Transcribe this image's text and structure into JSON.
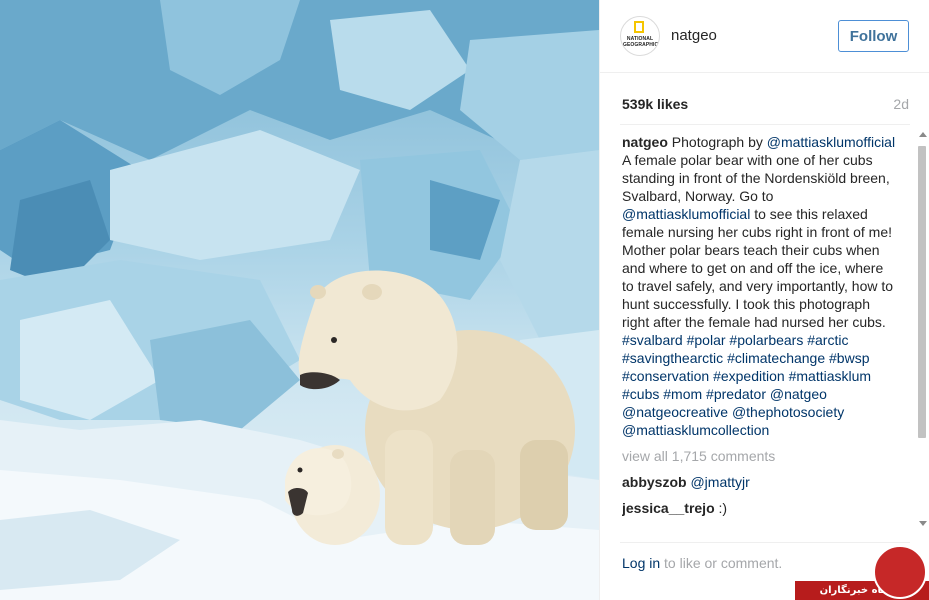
{
  "photo": {
    "alt": "Polar bear with cub on ice"
  },
  "header": {
    "username": "natgeo",
    "avatar_text": "NATIONAL GEOGRAPHIC",
    "follow_label": "Follow"
  },
  "stats": {
    "likes": "539k likes",
    "time_ago": "2d"
  },
  "caption": {
    "user": "natgeo",
    "t1": " Photograph by ",
    "m1": "@mattiasklumofficial",
    "t2": " A female polar bear with one of her cubs standing in front of the Nordenskiöld breen, Svalbard, Norway. Go to ",
    "m2": "@mattiasklumofficial",
    "t3": " to see this relaxed female nursing her cubs right in front of me! Mother polar bears teach their cubs when and where to get on and off the ice, where to travel safely, and very importantly, how to hunt successfully. I took this photograph right after the female had nursed her cubs. ",
    "tags": [
      "#svalbard",
      "#polar",
      "#polarbears",
      "#arctic",
      "#savingthearctic",
      "#climatechange",
      "#bwsp",
      "#conservation",
      "#expedition",
      "#mattiasklum",
      "#cubs",
      "#mom",
      "#predator",
      "@natgeo",
      "@natgeocreative",
      "@thephotosociety",
      "@mattiasklumcollection"
    ]
  },
  "view_all": "view all 1,715 comments",
  "comments": [
    {
      "user": "abbyszob",
      "text": "@jmattyjr"
    },
    {
      "user": "jessica__trejo",
      "text": ":)"
    }
  ],
  "footer": {
    "login_link": "Log in",
    "login_rest": " to like or comment."
  },
  "watermark": {
    "text": "باشگاه خبرنگاران"
  },
  "colors": {
    "link": "#003569",
    "follow_border": "#4d8fd6",
    "muted": "#a5a7aa",
    "watermark": "#b71c1c"
  }
}
